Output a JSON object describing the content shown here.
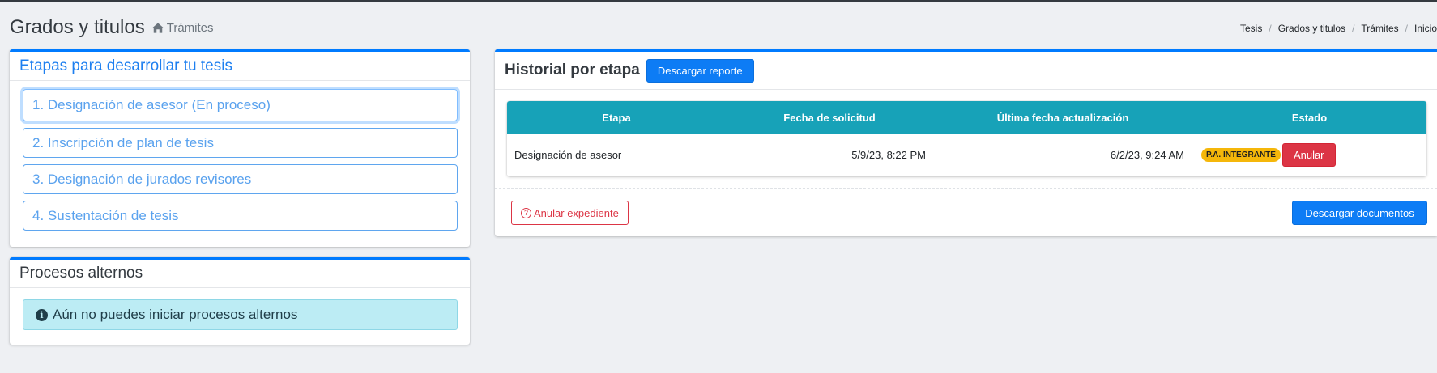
{
  "header": {
    "title": "Grados y titulos",
    "subtitle": "Trámites",
    "subtitle_icon": "home-icon"
  },
  "breadcrumb": [
    "Tesis",
    "Grados y titulos",
    "Trámites",
    "Inicio"
  ],
  "etapas_card": {
    "title": "Etapas para desarrollar tu tesis",
    "items": [
      {
        "label": "1. Designación de asesor (En proceso)",
        "active": true
      },
      {
        "label": "2. Inscripción de plan de tesis",
        "active": false
      },
      {
        "label": "3. Designación de jurados revisores",
        "active": false
      },
      {
        "label": "4. Sustentación de tesis",
        "active": false
      }
    ]
  },
  "alternos_card": {
    "title": "Procesos alternos",
    "alert": "Aún no puedes iniciar procesos alternos",
    "alert_icon": "info-icon"
  },
  "historial_card": {
    "title": "Historial por etapa",
    "download_report_label": "Descargar reporte",
    "table": {
      "headers": [
        "Etapa",
        "Fecha de solicitud",
        "Última fecha actualización",
        "Estado"
      ],
      "rows": [
        {
          "etapa": "Designación de asesor",
          "fecha_solicitud": "5/9/23, 8:22 PM",
          "ultima_actualizacion": "6/2/23, 9:24 AM",
          "estado_badge": "P.A. INTEGRANTE",
          "action_label": "Anular"
        }
      ]
    },
    "anular_expediente_label": "Anular expediente",
    "descargar_documentos_label": "Descargar documentos"
  },
  "colors": {
    "primary": "#007bff",
    "info_header": "#17a2b8",
    "danger": "#dc3545",
    "warning": "#f5b70a"
  }
}
